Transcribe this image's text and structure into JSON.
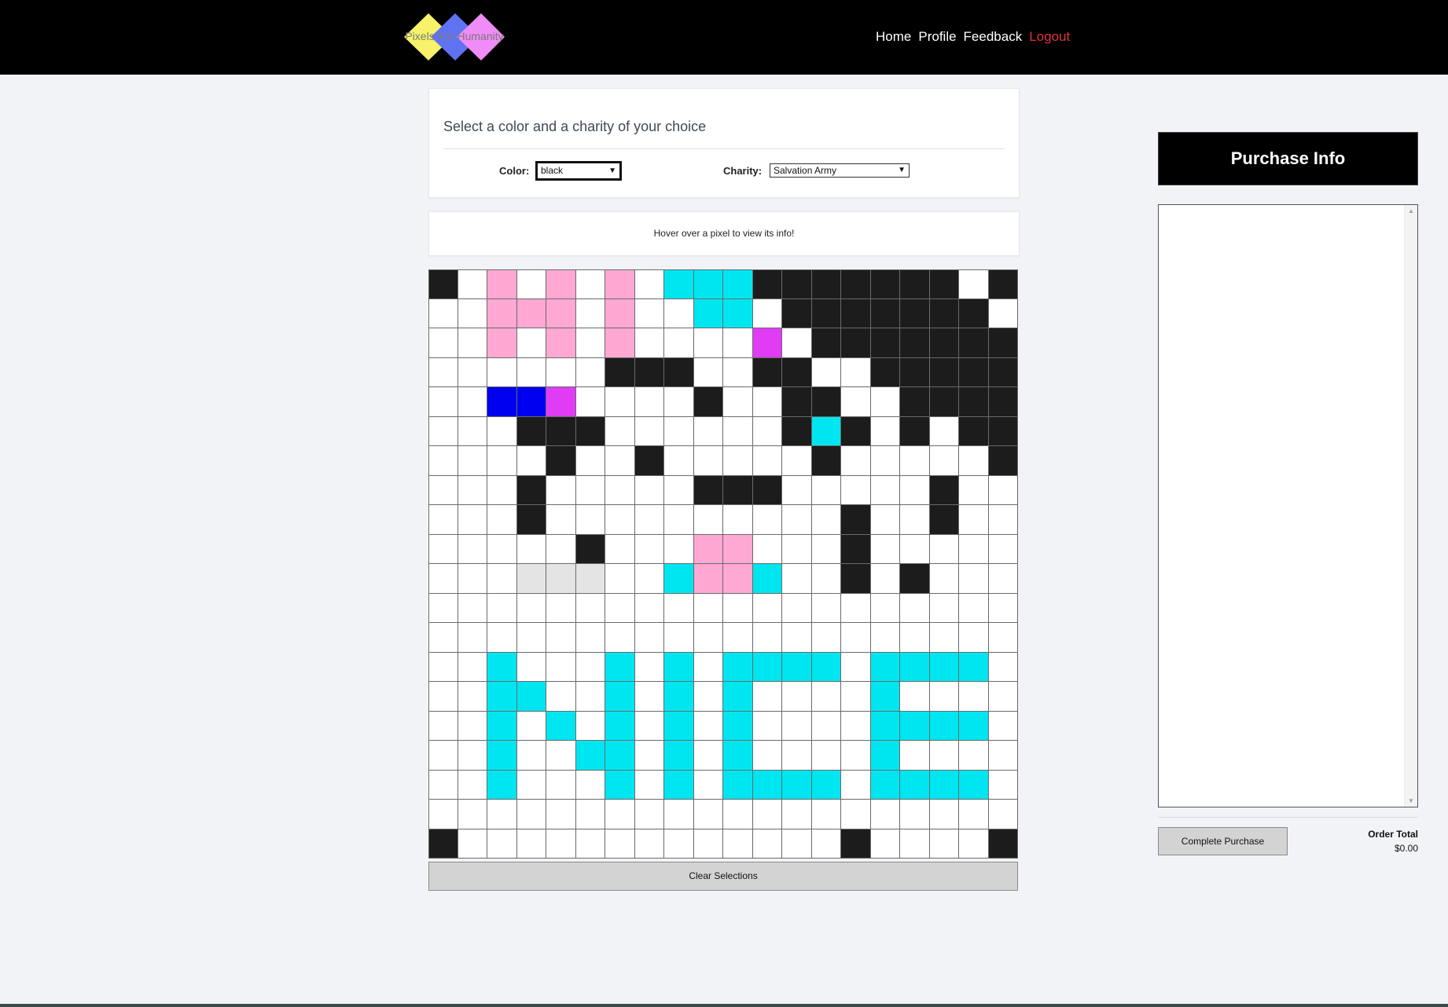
{
  "nav": {
    "logo_text": "Pixels For Humanity",
    "links": [
      "Home",
      "Profile",
      "Feedback"
    ],
    "logout": "Logout"
  },
  "selection": {
    "title": "Select a color and a charity of your choice",
    "color_label": "Color:",
    "color_value": "black",
    "charity_label": "Charity:",
    "charity_value": "Salvation Army"
  },
  "hover_info": "Hover over a pixel to view its info!",
  "palette": {
    "W": "#ffffff",
    "K": "#1c1c1c",
    "P": "#ffa8d4",
    "C": "#00e6f0",
    "M": "#e03cf5",
    "B": "#0000f0",
    "G": "#e4e4e4"
  },
  "canvas": {
    "rows": [
      "KWPWPWPWCCCKKKKKKKWK",
      "WWPPPWPWWCCWKKKKKKKW",
      "WWPWPWPWWWWMWKKKKKKK",
      "WWWWWWKKKWWKKWWKKKKK",
      "WWBBMWWWWKWWKKWWKKKK",
      "WWWKKKWWWWWWKCKWKWKK",
      "WWWWKWWKWWWWWKWWWWWK",
      "WWWKWWWWWKKKWWWWWKWW",
      "WWWKWWWWWWWWWWKWWKWW",
      "WWWWWKWWWPPWWWKWWWWW",
      "WWWGGGWWCPPCWWKWKWWW",
      "WWWWWWWWWWWWWWWWWWWW",
      "WWWWWWWWWWWWWWWWWWWW",
      "WWCWWWCWCWCCCCWCCCCW",
      "WWCCWWCWCWCWWWWCWWWW",
      "WWCWCWCWCWCWWWWCCCCW",
      "WWCWWCCWCWCWWWWCWWWW",
      "WWCWWWCWCWCCCCWCCCCW",
      "WWWWWWWWWWWWWWWWWWWW",
      "KWWWWWWWWWWWWWKWWWWK"
    ]
  },
  "clear_button": "Clear Selections",
  "purchase": {
    "title": "Purchase Info",
    "complete_button": "Complete Purchase",
    "order_total_label": "Order Total",
    "order_total_value": "$0.00"
  }
}
